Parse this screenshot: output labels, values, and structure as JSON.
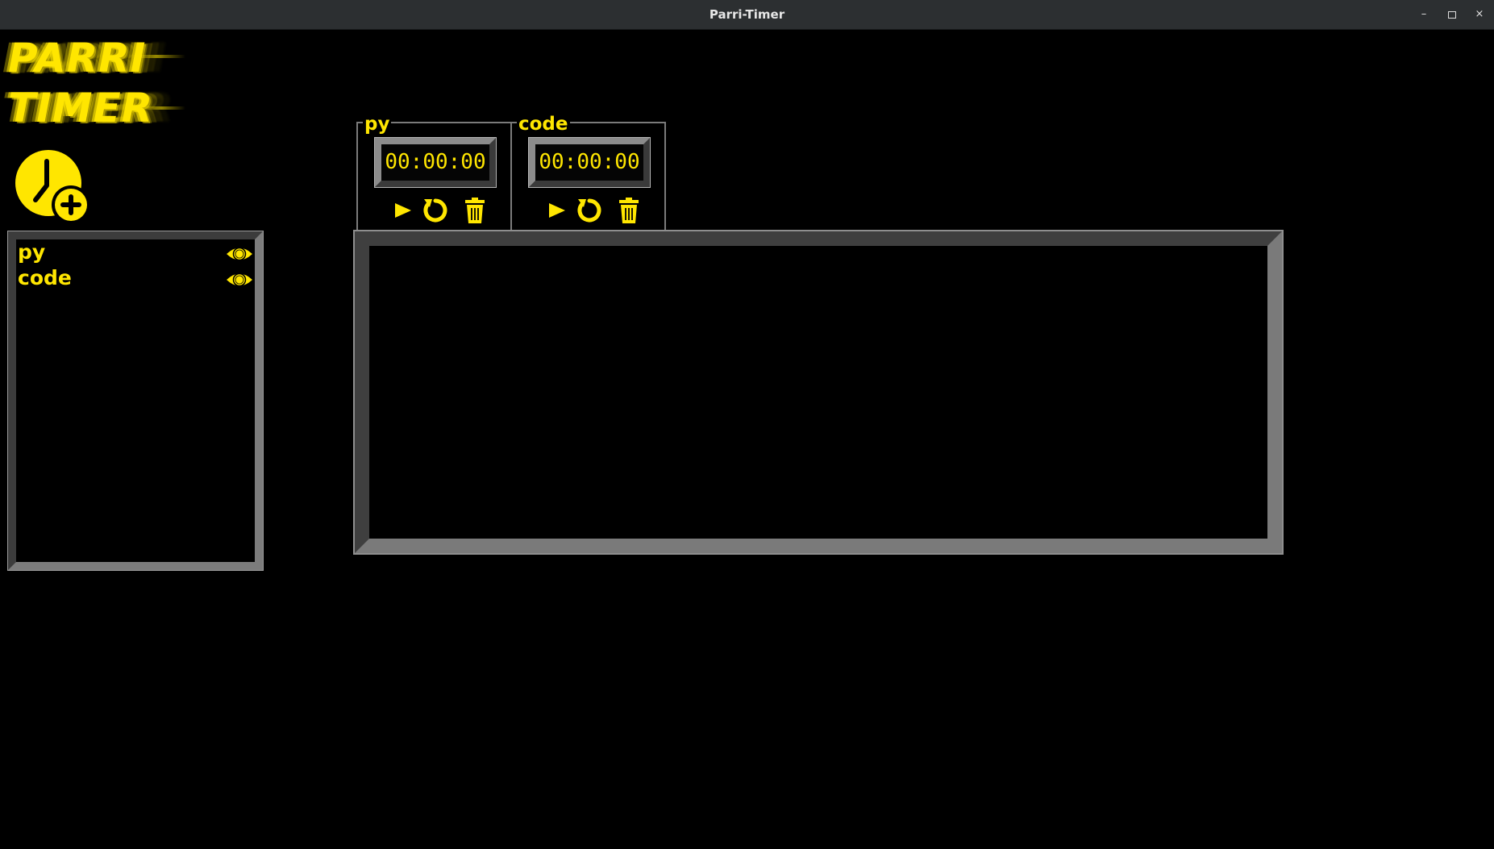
{
  "window": {
    "title": "Parri-Timer",
    "controls": {
      "minimize": "–",
      "close": "×"
    }
  },
  "logo": {
    "line1": "PARRI",
    "line2": "TIMER"
  },
  "add_timer_button": {
    "icon": "clock-add-icon"
  },
  "timer_list": {
    "items": [
      {
        "label": "py",
        "icon": "eye-icon"
      },
      {
        "label": "code",
        "icon": "eye-icon"
      }
    ]
  },
  "timers": [
    {
      "name": "py",
      "time": "00:00:00",
      "controls": [
        "play-icon",
        "reset-icon",
        "trash-icon"
      ]
    },
    {
      "name": "code",
      "time": "00:00:00",
      "controls": [
        "play-icon",
        "reset-icon",
        "trash-icon"
      ]
    }
  ],
  "colors": {
    "accent": "#ffe600",
    "background": "#000000",
    "titlebar": "#2c2f31",
    "bevel_light": "#7c7c7c",
    "bevel_dark": "#3c3c3c"
  }
}
